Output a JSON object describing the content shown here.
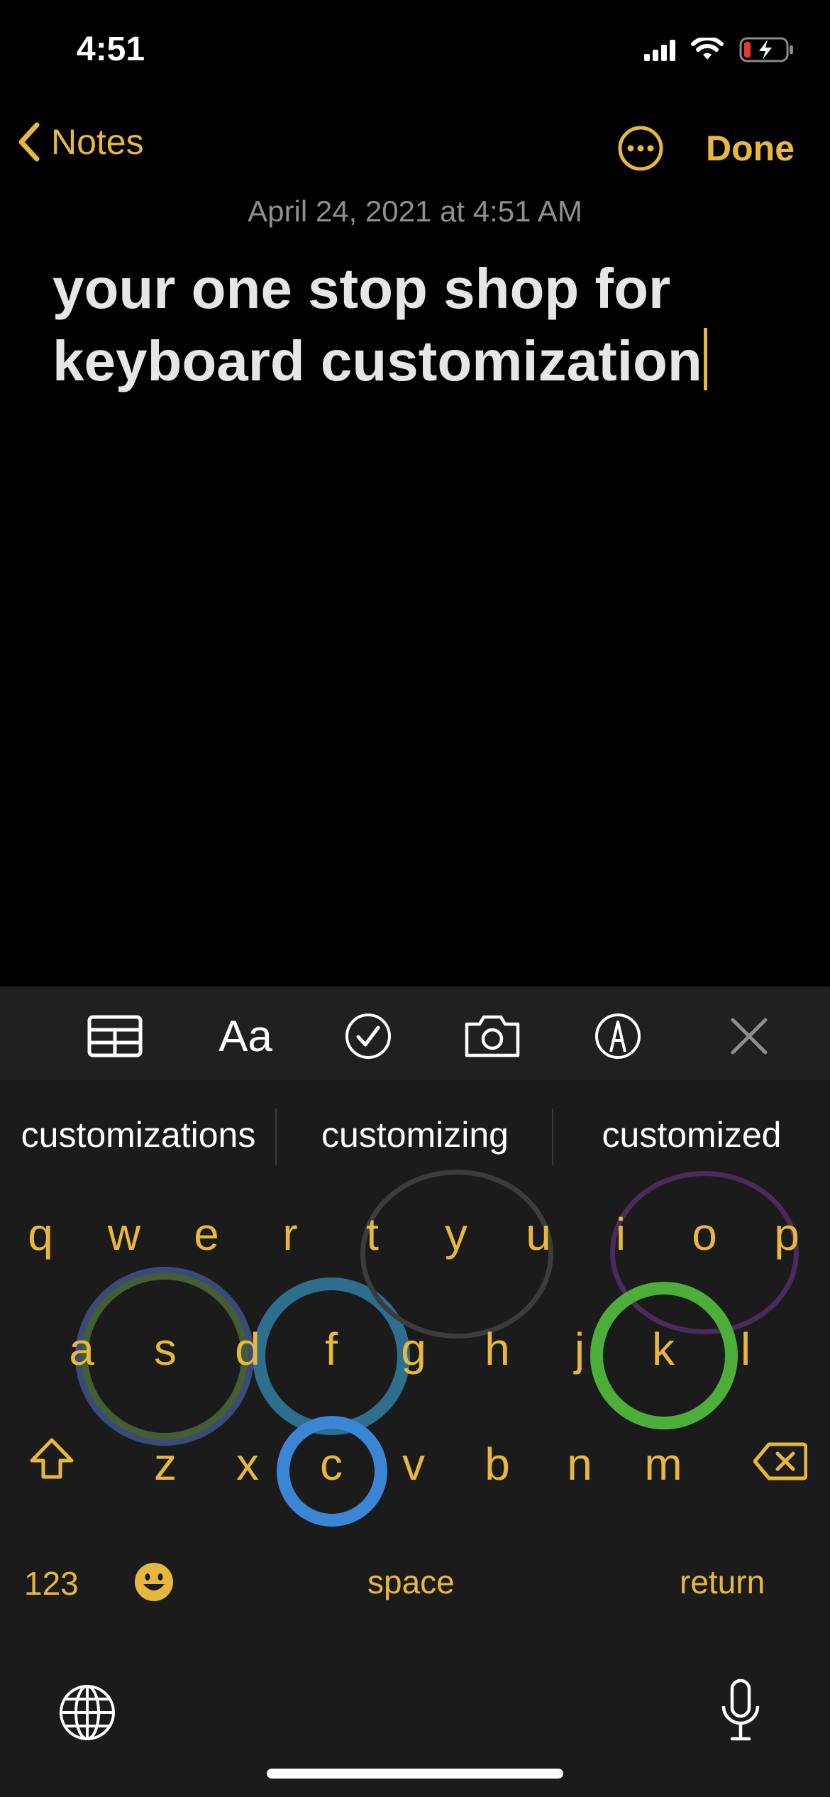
{
  "status": {
    "time": "4:51"
  },
  "nav": {
    "back_label": "Notes",
    "done_label": "Done"
  },
  "note": {
    "date": "April 24, 2021 at 4:51 AM",
    "line1": "your one stop shop for",
    "line2": "keyboard customization"
  },
  "suggestions": [
    "customizations",
    "customizing",
    "customized"
  ],
  "keyboard": {
    "row1": [
      "q",
      "w",
      "e",
      "r",
      "t",
      "y",
      "u",
      "i",
      "o",
      "p"
    ],
    "row2": [
      "a",
      "s",
      "d",
      "f",
      "g",
      "h",
      "j",
      "k",
      "l"
    ],
    "row3": [
      "z",
      "x",
      "c",
      "v",
      "b",
      "n",
      "m"
    ],
    "numbers_label": "123",
    "space_label": "space",
    "return_label": "return"
  },
  "colors": {
    "accent": "#e8b83e",
    "background": "#000000",
    "keyboard": "#1b1b1b",
    "battery_low": "#e53935",
    "ring_blue": "#3a86d4",
    "ring_green": "#4caf3a",
    "ring_teal": "#2e6f8e",
    "ring_purple": "#4a2b5c",
    "ring_gray": "#3c3c3c"
  },
  "icons": {
    "status": [
      "cellular-icon",
      "wifi-icon",
      "battery-charging-icon"
    ],
    "format_bar": [
      "table-icon",
      "text-format-icon",
      "checklist-icon",
      "camera-icon",
      "markup-icon",
      "close-icon"
    ],
    "keyboard": [
      "shift-icon",
      "backspace-icon",
      "emoji-icon",
      "globe-icon",
      "microphone-icon"
    ]
  }
}
